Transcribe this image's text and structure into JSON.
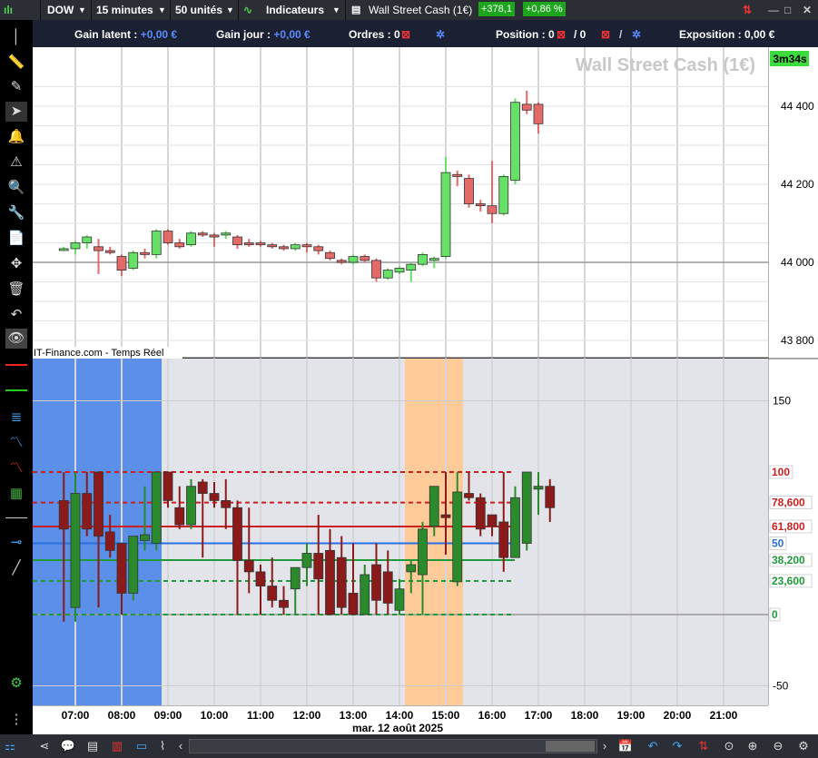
{
  "toolbar": {
    "symbol": "DOW",
    "timeframe": "15 minutes",
    "units": "50 unités",
    "indicators": "Indicateurs",
    "instrument": "Wall Street Cash (1€)",
    "change_points": "+378,1",
    "change_percent": "+0,86 %"
  },
  "infobar": {
    "gain_latent_label": "Gain latent :",
    "gain_latent_value": "+0,00 €",
    "gain_jour_label": "Gain jour :",
    "gain_jour_value": "+0,00 €",
    "ordres_label": "Ordres : 0",
    "position_label": "Position : 0",
    "position_sep": "/ 0",
    "exposition_label": "Exposition : 0,00 €"
  },
  "chart": {
    "watermark": "Wall Street Cash (1€)",
    "countdown": "3m34s",
    "source": "IT-Finance.com - Temps Réel",
    "date_label": "mar. 12 août 2025",
    "price_ticks": [
      "44 400",
      "44 200",
      "44 000",
      "43 800"
    ],
    "osc_ticks": [
      "150",
      "-50"
    ],
    "time_ticks": [
      "07:00",
      "08:00",
      "09:00",
      "10:00",
      "11:00",
      "12:00",
      "13:00",
      "14:00",
      "15:00",
      "16:00",
      "17:00",
      "18:00",
      "19:00",
      "20:00",
      "21:00"
    ],
    "fib_levels": [
      {
        "label": "100",
        "color": "#cc2020"
      },
      {
        "label": "78,600",
        "color": "#cc2020"
      },
      {
        "label": "61,800",
        "color": "#cc2020"
      },
      {
        "label": "50",
        "color": "#2a6fe0"
      },
      {
        "label": "38,200",
        "color": "#1f9a3a"
      },
      {
        "label": "23,600",
        "color": "#1f9a3a"
      },
      {
        "label": "0",
        "color": "#1f9a3a"
      }
    ],
    "colors": {
      "up": "#2fa82f",
      "down": "#d34f4f",
      "osc_up": "#2b8a2b",
      "osc_down": "#8b1a1a",
      "session_blue": "#5b8fe8",
      "session_orange": "#ffcc99"
    }
  },
  "chart_data": [
    {
      "type": "candlestick",
      "title": "Wall Street Cash (1€)",
      "x_unit": "time",
      "y_ticks": [
        43800,
        44000,
        44200,
        44400
      ],
      "candles": [
        {
          "t": "06:45",
          "o": 44035,
          "h": 44040,
          "l": 44030,
          "c": 44035
        },
        {
          "t": "07:00",
          "o": 44035,
          "h": 44055,
          "l": 44020,
          "c": 44050
        },
        {
          "t": "07:15",
          "o": 44050,
          "h": 44070,
          "l": 44035,
          "c": 44065
        },
        {
          "t": "07:30",
          "o": 44040,
          "h": 44060,
          "l": 43970,
          "c": 44030
        },
        {
          "t": "07:45",
          "o": 44030,
          "h": 44040,
          "l": 44020,
          "c": 44025
        },
        {
          "t": "08:00",
          "o": 44015,
          "h": 44020,
          "l": 43965,
          "c": 43980
        },
        {
          "t": "08:15",
          "o": 43985,
          "h": 44030,
          "l": 43980,
          "c": 44025
        },
        {
          "t": "08:30",
          "o": 44025,
          "h": 44035,
          "l": 44010,
          "c": 44020
        },
        {
          "t": "08:45",
          "o": 44020,
          "h": 44085,
          "l": 44010,
          "c": 44080
        },
        {
          "t": "09:00",
          "o": 44080,
          "h": 44085,
          "l": 44045,
          "c": 44050
        },
        {
          "t": "09:15",
          "o": 44050,
          "h": 44060,
          "l": 44035,
          "c": 44040
        },
        {
          "t": "09:30",
          "o": 44045,
          "h": 44080,
          "l": 44040,
          "c": 44075
        },
        {
          "t": "09:45",
          "o": 44075,
          "h": 44080,
          "l": 44065,
          "c": 44070
        },
        {
          "t": "10:00",
          "o": 44070,
          "h": 44075,
          "l": 44040,
          "c": 44065
        },
        {
          "t": "10:15",
          "o": 44070,
          "h": 44080,
          "l": 44060,
          "c": 44075
        },
        {
          "t": "10:30",
          "o": 44065,
          "h": 44070,
          "l": 44035,
          "c": 44045
        },
        {
          "t": "10:45",
          "o": 44050,
          "h": 44060,
          "l": 44040,
          "c": 44045
        },
        {
          "t": "11:00",
          "o": 44050,
          "h": 44055,
          "l": 44040,
          "c": 44045
        },
        {
          "t": "11:15",
          "o": 44045,
          "h": 44050,
          "l": 44035,
          "c": 44040
        },
        {
          "t": "11:30",
          "o": 44040,
          "h": 44045,
          "l": 44030,
          "c": 44035
        },
        {
          "t": "11:45",
          "o": 44035,
          "h": 44050,
          "l": 44030,
          "c": 44045
        },
        {
          "t": "12:00",
          "o": 44045,
          "h": 44050,
          "l": 44025,
          "c": 44040
        },
        {
          "t": "12:15",
          "o": 44040,
          "h": 44045,
          "l": 44020,
          "c": 44030
        },
        {
          "t": "12:30",
          "o": 44025,
          "h": 44030,
          "l": 44005,
          "c": 44010
        },
        {
          "t": "12:45",
          "o": 44005,
          "h": 44010,
          "l": 43995,
          "c": 44000
        },
        {
          "t": "13:00",
          "o": 44000,
          "h": 44020,
          "l": 43995,
          "c": 44015
        },
        {
          "t": "13:15",
          "o": 44015,
          "h": 44020,
          "l": 44000,
          "c": 44005
        },
        {
          "t": "13:30",
          "o": 44005,
          "h": 44010,
          "l": 43950,
          "c": 43960
        },
        {
          "t": "13:45",
          "o": 43960,
          "h": 43985,
          "l": 43955,
          "c": 43980
        },
        {
          "t": "14:00",
          "o": 43975,
          "h": 43990,
          "l": 43970,
          "c": 43985
        },
        {
          "t": "14:15",
          "o": 43980,
          "h": 44000,
          "l": 43950,
          "c": 43995
        },
        {
          "t": "14:30",
          "o": 43995,
          "h": 44025,
          "l": 43990,
          "c": 44020
        },
        {
          "t": "14:45",
          "o": 44005,
          "h": 44015,
          "l": 43985,
          "c": 44010
        },
        {
          "t": "15:00",
          "o": 44015,
          "h": 44270,
          "l": 44010,
          "c": 44230
        },
        {
          "t": "15:15",
          "o": 44225,
          "h": 44235,
          "l": 44195,
          "c": 44220
        },
        {
          "t": "15:30",
          "o": 44215,
          "h": 44225,
          "l": 44140,
          "c": 44150
        },
        {
          "t": "15:45",
          "o": 44150,
          "h": 44160,
          "l": 44130,
          "c": 44145
        },
        {
          "t": "16:00",
          "o": 44145,
          "h": 44260,
          "l": 44100,
          "c": 44125
        },
        {
          "t": "16:15",
          "o": 44125,
          "h": 44225,
          "l": 44120,
          "c": 44220
        },
        {
          "t": "16:30",
          "o": 44210,
          "h": 44420,
          "l": 44200,
          "c": 44410
        },
        {
          "t": "16:45",
          "o": 44405,
          "h": 44440,
          "l": 44380,
          "c": 44390
        },
        {
          "t": "17:00",
          "o": 44405,
          "h": 44410,
          "l": 44330,
          "c": 44355
        }
      ]
    },
    {
      "type": "candlestick",
      "title": "oscillator",
      "y_ticks": [
        -50,
        0,
        50,
        100,
        150
      ],
      "candles": [
        {
          "t": "06:45",
          "o": 80,
          "h": 100,
          "l": -5,
          "c": 60
        },
        {
          "t": "07:00",
          "o": 5,
          "h": 100,
          "l": -5,
          "c": 85
        },
        {
          "t": "07:15",
          "o": 85,
          "h": 100,
          "l": 55,
          "c": 60
        },
        {
          "t": "07:30",
          "o": 100,
          "h": 100,
          "l": 5,
          "c": 55
        },
        {
          "t": "07:45",
          "o": 58,
          "h": 70,
          "l": 40,
          "c": 45
        },
        {
          "t": "08:00",
          "o": 50,
          "h": 50,
          "l": 0,
          "c": 15
        },
        {
          "t": "08:15",
          "o": 15,
          "h": 55,
          "l": 10,
          "c": 55
        },
        {
          "t": "08:30",
          "o": 52,
          "h": 90,
          "l": 45,
          "c": 56
        },
        {
          "t": "08:45",
          "o": 50,
          "h": 100,
          "l": 45,
          "c": 100
        },
        {
          "t": "09:00",
          "o": 100,
          "h": 100,
          "l": 75,
          "c": 80
        },
        {
          "t": "09:15",
          "o": 75,
          "h": 90,
          "l": 60,
          "c": 63
        },
        {
          "t": "09:30",
          "o": 63,
          "h": 95,
          "l": 60,
          "c": 90
        },
        {
          "t": "09:45",
          "o": 93,
          "h": 95,
          "l": 40,
          "c": 85
        },
        {
          "t": "10:00",
          "o": 85,
          "h": 93,
          "l": 75,
          "c": 80
        },
        {
          "t": "10:15",
          "o": 80,
          "h": 95,
          "l": 60,
          "c": 75
        },
        {
          "t": "10:30",
          "o": 75,
          "h": 80,
          "l": 0,
          "c": 38
        },
        {
          "t": "10:45",
          "o": 38,
          "h": 75,
          "l": 15,
          "c": 30
        },
        {
          "t": "11:00",
          "o": 30,
          "h": 35,
          "l": 0,
          "c": 20
        },
        {
          "t": "11:15",
          "o": 20,
          "h": 40,
          "l": 5,
          "c": 10
        },
        {
          "t": "11:30",
          "o": 10,
          "h": 20,
          "l": 0,
          "c": 5
        },
        {
          "t": "11:45",
          "o": 18,
          "h": 30,
          "l": 0,
          "c": 33
        },
        {
          "t": "12:00",
          "o": 33,
          "h": 50,
          "l": 20,
          "c": 43
        },
        {
          "t": "12:15",
          "o": 43,
          "h": 70,
          "l": 0,
          "c": 25
        },
        {
          "t": "12:30",
          "o": 45,
          "h": 60,
          "l": 0,
          "c": 0
        },
        {
          "t": "12:45",
          "o": 40,
          "h": 55,
          "l": 0,
          "c": 5
        },
        {
          "t": "13:00",
          "o": 15,
          "h": 50,
          "l": 0,
          "c": 0
        },
        {
          "t": "13:15",
          "o": 0,
          "h": 35,
          "l": 0,
          "c": 28
        },
        {
          "t": "13:30",
          "o": 35,
          "h": 50,
          "l": 0,
          "c": 10
        },
        {
          "t": "13:45",
          "o": 30,
          "h": 45,
          "l": 0,
          "c": 8
        },
        {
          "t": "14:00",
          "o": 3,
          "h": 25,
          "l": 0,
          "c": 18
        },
        {
          "t": "14:15",
          "o": 30,
          "h": 38,
          "l": 15,
          "c": 35
        },
        {
          "t": "14:30",
          "o": 28,
          "h": 65,
          "l": 0,
          "c": 60
        },
        {
          "t": "14:45",
          "o": 62,
          "h": 90,
          "l": 55,
          "c": 90
        },
        {
          "t": "15:00",
          "o": 70,
          "h": 100,
          "l": 42,
          "c": 68
        },
        {
          "t": "15:15",
          "o": 23,
          "h": 100,
          "l": 20,
          "c": 86
        },
        {
          "t": "15:30",
          "o": 85,
          "h": 100,
          "l": 80,
          "c": 82
        },
        {
          "t": "15:45",
          "o": 82,
          "h": 85,
          "l": 55,
          "c": 60
        },
        {
          "t": "16:00",
          "o": 70,
          "h": 70,
          "l": 55,
          "c": 62
        },
        {
          "t": "16:15",
          "o": 65,
          "h": 100,
          "l": 30,
          "c": 40
        },
        {
          "t": "16:30",
          "o": 40,
          "h": 90,
          "l": 40,
          "c": 82
        },
        {
          "t": "16:45",
          "o": 50,
          "h": 100,
          "l": 45,
          "c": 100
        },
        {
          "t": "17:00",
          "o": 88,
          "h": 100,
          "l": 70,
          "c": 90
        },
        {
          "t": "17:15",
          "o": 90,
          "h": 95,
          "l": 65,
          "c": 75
        }
      ]
    }
  ]
}
